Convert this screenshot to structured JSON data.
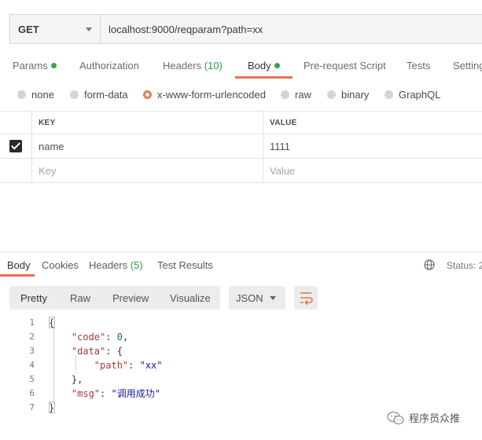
{
  "request": {
    "method": "GET",
    "url": "localhost:9000/reqparam?path=xx"
  },
  "request_tabs": [
    {
      "label": "Params",
      "count": "",
      "dot": true
    },
    {
      "label": "Authorization",
      "count": "",
      "dot": false
    },
    {
      "label": "Headers",
      "count": "(10)",
      "dot": false
    },
    {
      "label": "Body",
      "count": "",
      "dot": true,
      "active": true
    },
    {
      "label": "Pre-request Script",
      "count": "",
      "dot": false
    },
    {
      "label": "Tests",
      "count": "",
      "dot": false
    },
    {
      "label": "Setting",
      "count": "",
      "dot": false
    }
  ],
  "body_types": [
    {
      "label": "none",
      "selected": false
    },
    {
      "label": "form-data",
      "selected": false
    },
    {
      "label": "x-www-form-urlencoded",
      "selected": true
    },
    {
      "label": "raw",
      "selected": false
    },
    {
      "label": "binary",
      "selected": false
    },
    {
      "label": "GraphQL",
      "selected": false
    }
  ],
  "kv_table": {
    "headers": {
      "key": "KEY",
      "value": "VALUE"
    },
    "rows": [
      {
        "checked": true,
        "key": "name",
        "value": "1111"
      }
    ],
    "placeholder": {
      "key": "Key",
      "value": "Value"
    }
  },
  "response_tabs": [
    {
      "label": "Body",
      "count": "",
      "active": true
    },
    {
      "label": "Cookies",
      "count": ""
    },
    {
      "label": "Headers",
      "count": "(5)"
    },
    {
      "label": "Test Results",
      "count": ""
    }
  ],
  "status_label": "Status: 2",
  "format_buttons": [
    "Pretty",
    "Raw",
    "Preview",
    "Visualize"
  ],
  "format_select": "JSON",
  "code_lines": [
    "1",
    "2",
    "3",
    "4",
    "5",
    "6",
    "7"
  ],
  "json": {
    "open_brace": "{",
    "code_key": "\"code\"",
    "code_val": "0",
    "data_key": "\"data\"",
    "path_key": "\"path\"",
    "path_val": "\"xx\"",
    "msg_key": "\"msg\"",
    "msg_val": "\"调用成功\"",
    "close_brace": "}"
  },
  "watermark": "程序员众推",
  "colors": {
    "accent": "#e2764f",
    "dot_green": "#2ba94b",
    "count_green": "#2e9c45"
  }
}
